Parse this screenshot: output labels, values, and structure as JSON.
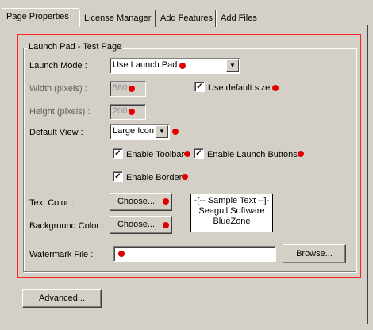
{
  "tabs": [
    {
      "label": "Page Properties",
      "active": true
    },
    {
      "label": "License Manager",
      "active": false
    },
    {
      "label": "Add Features",
      "active": false
    },
    {
      "label": "Add Files",
      "active": false
    }
  ],
  "group": {
    "title": "Launch Pad - Test Page"
  },
  "launch_mode": {
    "label": "Launch Mode :",
    "value": "Use Launch Pad"
  },
  "width": {
    "label": "Width (pixels) :",
    "value": "560"
  },
  "height": {
    "label": "Height (pixels) :",
    "value": "200"
  },
  "use_default_size": {
    "label": "Use default size",
    "checked": true
  },
  "default_view": {
    "label": "Default View :",
    "value": "Large Icon"
  },
  "enable_toolbar": {
    "label": "Enable Toolbar",
    "checked": true
  },
  "enable_launch_buttons": {
    "label": "Enable Launch Buttons",
    "checked": true
  },
  "enable_border": {
    "label": "Enable Border",
    "checked": true
  },
  "text_color": {
    "label": "Text Color :",
    "button": "Choose..."
  },
  "background_color": {
    "label": "Background Color :",
    "button": "Choose..."
  },
  "sample_text": {
    "line1": "-[-- Sample Text --]-",
    "line2": "Seagull Software",
    "line3": "BlueZone"
  },
  "watermark": {
    "label": "Watermark File :",
    "value": "",
    "button": "Browse..."
  },
  "advanced_button": "Advanced...",
  "colors": {
    "indicator": "#e00000",
    "highlight_frame": "#ff2020",
    "dialog_bg": "#d4d0c8"
  }
}
